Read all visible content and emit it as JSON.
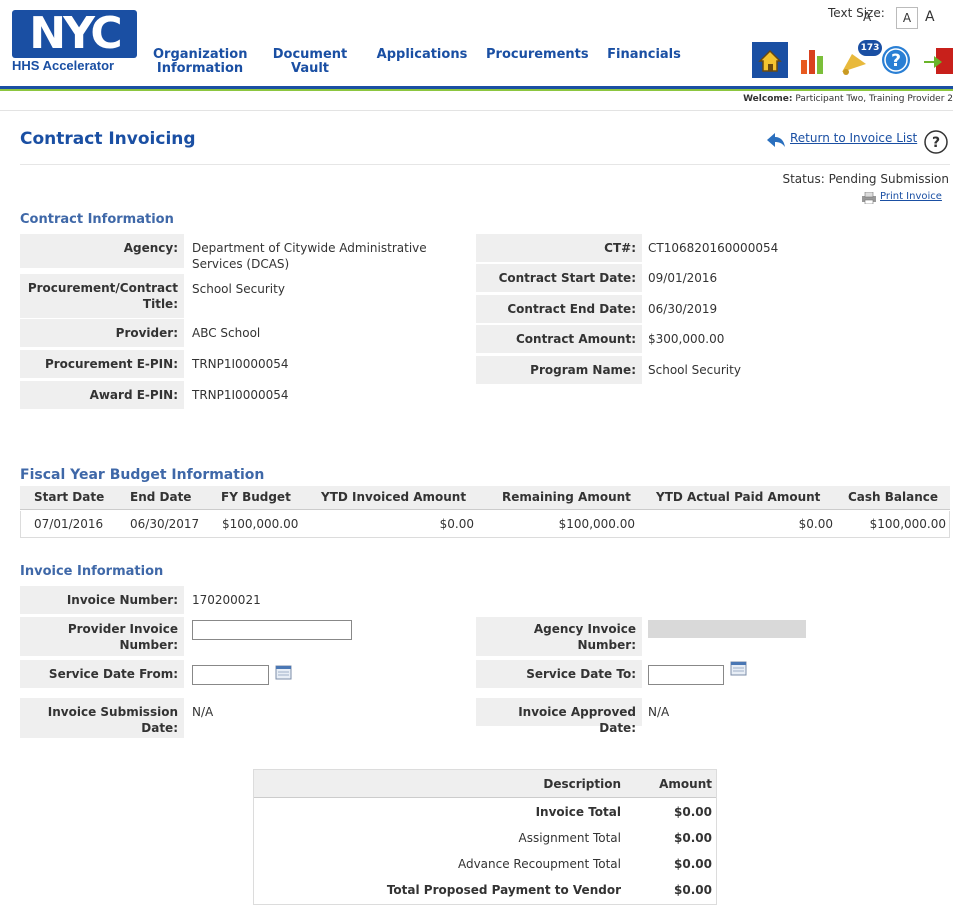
{
  "header": {
    "logo_text": "NYC",
    "logo_sub": "HHS Accelerator",
    "text_size_label": "Text Size:",
    "text_size_options": [
      "A",
      "A",
      "A"
    ],
    "nav": [
      {
        "label": "Organization Information"
      },
      {
        "label": "Document Vault"
      },
      {
        "label": "Applications"
      },
      {
        "label": "Procurements"
      },
      {
        "label": "Financials"
      }
    ],
    "notification_count": "173",
    "welcome_prefix": "Welcome:",
    "welcome_user": "Participant Two, Training Provider 2"
  },
  "page": {
    "title": "Contract Invoicing",
    "return_link": "Return to Invoice List",
    "status": "Status: Pending Submission",
    "print_link": "Print Invoice"
  },
  "contract": {
    "section_title": "Contract Information",
    "left": [
      {
        "label": "Agency:",
        "value": "Department of Citywide Administrative Services (DCAS)"
      },
      {
        "label": "Procurement/Contract Title:",
        "value": "School Security"
      },
      {
        "label": "Provider:",
        "value": "ABC School"
      },
      {
        "label": "Procurement E-PIN:",
        "value": "TRNP1I0000054"
      },
      {
        "label": "Award E-PIN:",
        "value": "TRNP1I0000054"
      }
    ],
    "right": [
      {
        "label": "CT#:",
        "value": "CT106820160000054"
      },
      {
        "label": "Contract Start Date:",
        "value": "09/01/2016"
      },
      {
        "label": "Contract End Date:",
        "value": "06/30/2019"
      },
      {
        "label": "Contract Amount:",
        "value": "$300,000.00"
      },
      {
        "label": "Program Name:",
        "value": "School Security"
      }
    ]
  },
  "fiscal": {
    "section_title": "Fiscal Year Budget Information",
    "headers": [
      "Start Date",
      "End Date",
      "FY Budget",
      "YTD Invoiced Amount",
      "Remaining Amount",
      "YTD Actual Paid Amount",
      "Cash Balance"
    ],
    "row": [
      "07/01/2016",
      "06/30/2017",
      "$100,000.00",
      "$0.00",
      "$100,000.00",
      "$0.00",
      "$100,000.00"
    ]
  },
  "invoice": {
    "section_title": "Invoice Information",
    "invoice_number_label": "Invoice Number:",
    "invoice_number": "170200021",
    "provider_invoice_label": "Provider Invoice Number:",
    "provider_invoice_value": "",
    "agency_invoice_label": "Agency Invoice Number:",
    "service_from_label": "Service Date From:",
    "service_from_value": "",
    "service_to_label": "Service Date To:",
    "service_to_value": "",
    "submission_label": "Invoice Submission Date:",
    "submission_value": "N/A",
    "approved_label": "Invoice Approved Date:",
    "approved_value": "N/A"
  },
  "summary": {
    "headers": {
      "description": "Description",
      "amount": "Amount"
    },
    "rows": [
      {
        "description": "Invoice Total",
        "amount": "$0.00"
      },
      {
        "description": "Assignment Total",
        "amount": "$0.00"
      },
      {
        "description": "Advance Recoupment Total",
        "amount": "$0.00"
      },
      {
        "description": "Total Proposed Payment to Vendor",
        "amount": "$0.00"
      }
    ]
  },
  "colors": {
    "brand_blue": "#1a4fa3",
    "accent_green": "#8cc63f",
    "section_blue": "#3f68a8"
  }
}
